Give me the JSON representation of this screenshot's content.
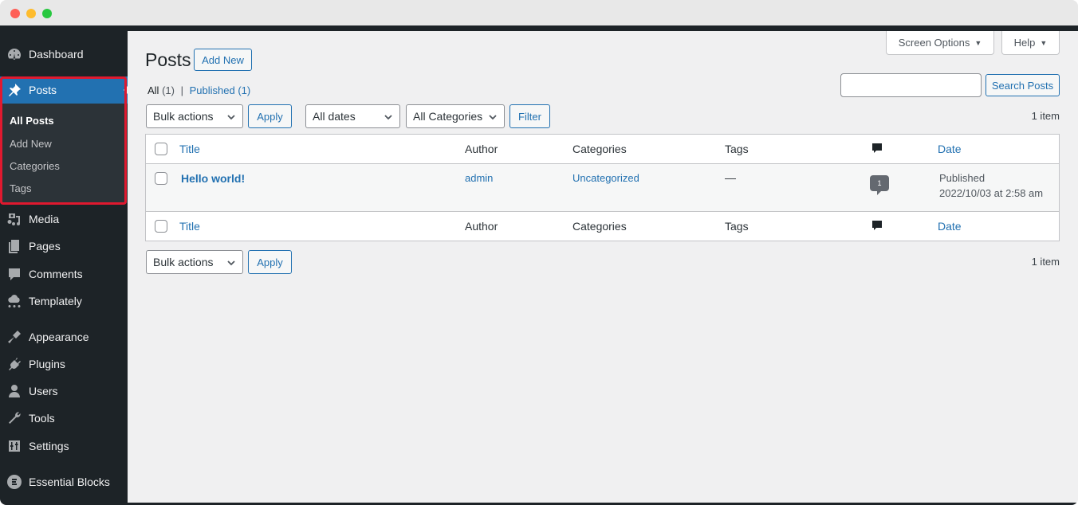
{
  "window": {
    "controls": [
      "close",
      "minimize",
      "maximize"
    ]
  },
  "sidebar": {
    "items": [
      {
        "label": "Dashboard",
        "icon": "dashboard-icon"
      },
      {
        "label": "Posts",
        "icon": "pin-icon",
        "active": true
      },
      {
        "label": "Media",
        "icon": "media-icon"
      },
      {
        "label": "Pages",
        "icon": "pages-icon"
      },
      {
        "label": "Comments",
        "icon": "comments-icon"
      },
      {
        "label": "Templately",
        "icon": "templately-icon"
      },
      {
        "label": "Appearance",
        "icon": "appearance-icon"
      },
      {
        "label": "Plugins",
        "icon": "plugins-icon"
      },
      {
        "label": "Users",
        "icon": "users-icon"
      },
      {
        "label": "Tools",
        "icon": "tools-icon"
      },
      {
        "label": "Settings",
        "icon": "settings-icon"
      },
      {
        "label": "Essential Blocks",
        "icon": "essential-blocks-icon"
      }
    ],
    "submenu": [
      {
        "label": "All Posts",
        "current": true
      },
      {
        "label": "Add New"
      },
      {
        "label": "Categories"
      },
      {
        "label": "Tags"
      }
    ],
    "highlight_color": "#e0192f"
  },
  "header": {
    "title": "Posts",
    "add_new": "Add New",
    "screen_options": "Screen Options",
    "help": "Help",
    "dropdown_arrow": "▼"
  },
  "views": {
    "all_label": "All",
    "all_count": "(1)",
    "separator": "|",
    "published_label": "Published",
    "published_count": "(1)"
  },
  "search": {
    "value": "",
    "button": "Search Posts"
  },
  "filters": {
    "bulk_actions": "Bulk actions",
    "apply": "Apply",
    "dates": "All dates",
    "categories": "All Categories",
    "filter": "Filter",
    "item_count": "1 item"
  },
  "table": {
    "columns": {
      "title": "Title",
      "author": "Author",
      "categories": "Categories",
      "tags": "Tags",
      "comments_icon": "comment-icon",
      "date": "Date"
    },
    "rows": [
      {
        "title": "Hello world!",
        "author": "admin",
        "categories": "Uncategorized",
        "tags": "—",
        "comments": "1",
        "date_status": "Published",
        "date": "2022/10/03 at 2:58 am"
      }
    ]
  },
  "bottom_filters": {
    "bulk_actions": "Bulk actions",
    "apply": "Apply",
    "item_count": "1 item"
  },
  "colors": {
    "accent": "#2271b1",
    "sidebar_bg": "#1d2327",
    "submenu_bg": "#2c3338",
    "content_bg": "#f0f0f1"
  }
}
